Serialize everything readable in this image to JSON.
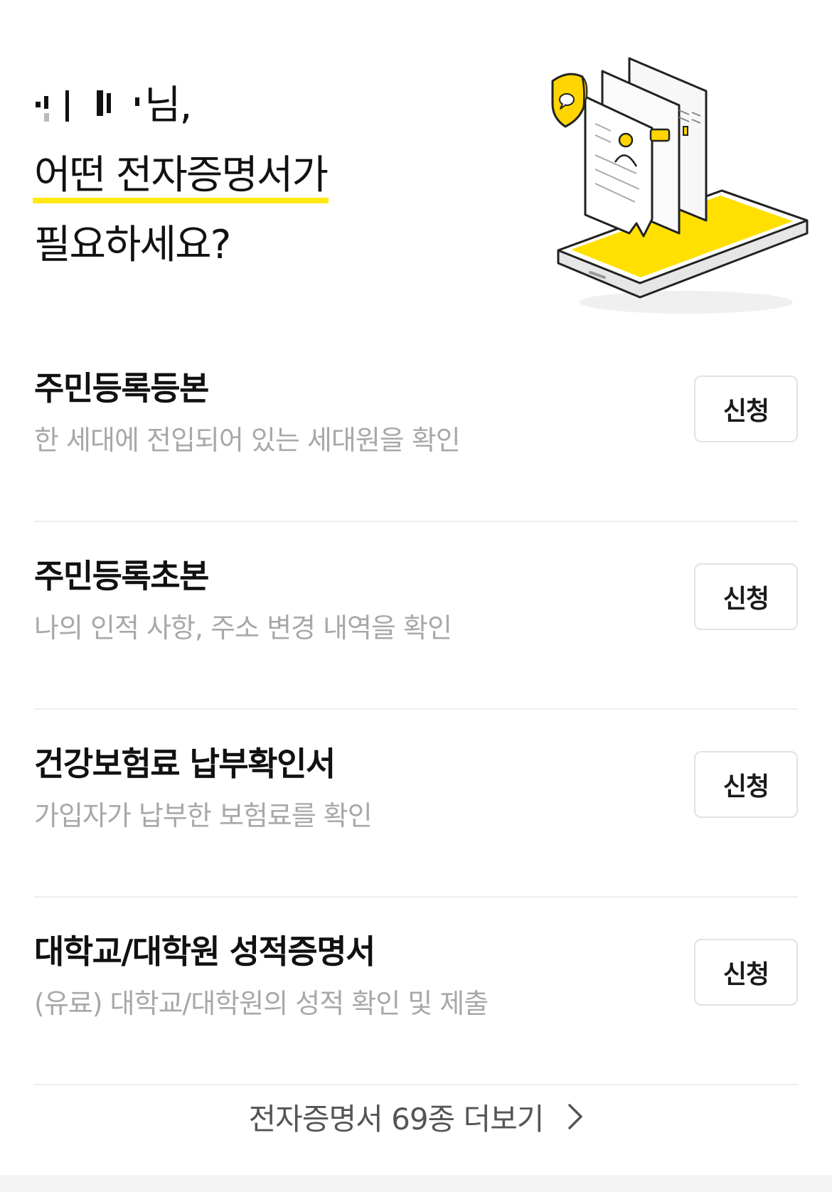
{
  "header": {
    "greeting_suffix": "님,",
    "line2": "어떤 전자증명서가",
    "line3": "필요하세요?"
  },
  "certificates": [
    {
      "title": "주민등록등본",
      "description": "한 세대에 전입되어 있는 세대원을 확인",
      "action": "신청"
    },
    {
      "title": "주민등록초본",
      "description": "나의 인적 사항, 주소 변경 내역을 확인",
      "action": "신청"
    },
    {
      "title": "건강보험료 납부확인서",
      "description": "가입자가 납부한 보험료를 확인",
      "action": "신청"
    },
    {
      "title": "대학교/대학원 성적증명서",
      "description": "(유료) 대학교/대학원의 성적 확인 및 제출",
      "action": "신청"
    }
  ],
  "more_link": {
    "label": "전자증명서 69종 더보기",
    "icon": "chevron-right-icon"
  },
  "colors": {
    "accent_yellow": "#ffe812",
    "text_primary": "#111111",
    "text_secondary": "#a8a8a8"
  }
}
